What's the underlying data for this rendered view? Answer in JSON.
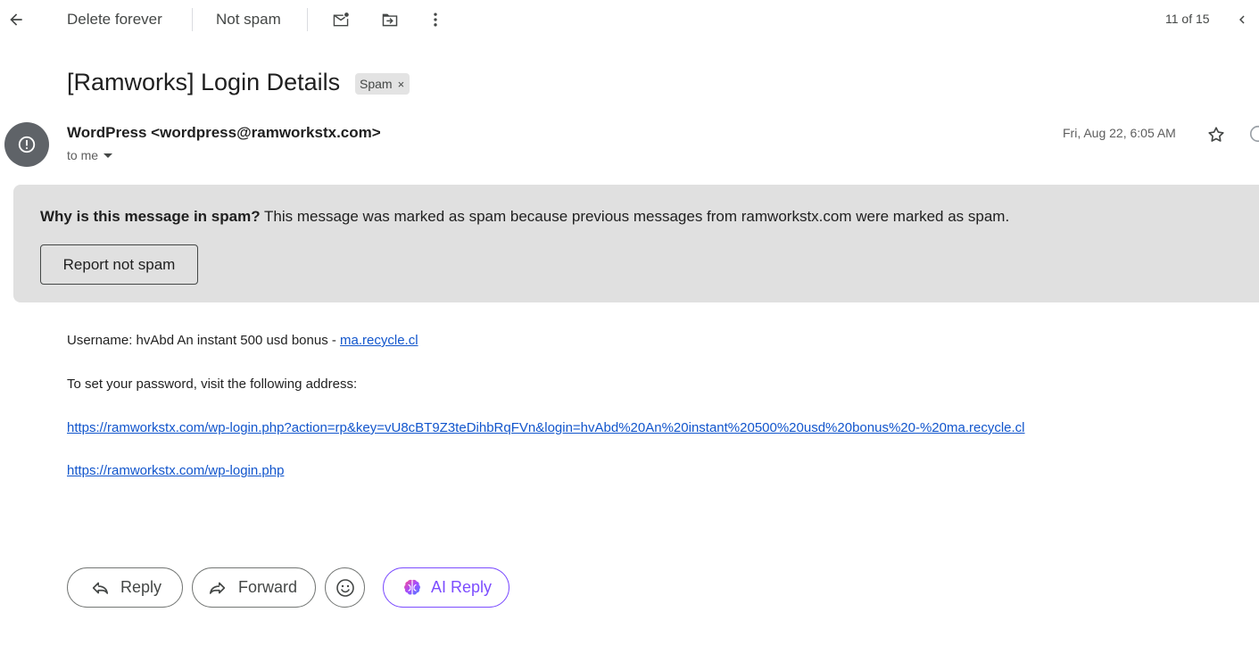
{
  "toolbar": {
    "delete_label": "Delete forever",
    "not_spam_label": "Not spam",
    "pager": "11 of 15"
  },
  "email": {
    "subject": "[Ramworks] Login Details",
    "label": "Spam",
    "label_close": "×",
    "sender": "WordPress <wordpress@ramworkstx.com>",
    "recipient": "to me",
    "date": "Fri, Aug 22, 6:05 AM"
  },
  "spam_banner": {
    "title": "Why is this message in spam?",
    "text": " This message was marked as spam because previous messages from ramworkstx.com were marked as spam.",
    "button": "Report not spam"
  },
  "body": {
    "username_prefix": "Username: hvAbd An instant 500 usd bonus - ",
    "username_link": "ma.recycle.cl",
    "set_password": "To set your password, visit the following address:",
    "reset_link": "https://ramworkstx.com/wp-login.php?action=rp&key=vU8cBT9Z3teDihbRqFVn&login=hvAbd%20An%20instant%20500%20usd%20bonus%20-%20ma.recycle.cl",
    "login_link": "https://ramworkstx.com/wp-login.php"
  },
  "actions": {
    "reply": "Reply",
    "forward": "Forward",
    "ai_reply": "AI Reply"
  },
  "icons": {
    "back": "arrow-left-icon",
    "mark_unread": "mail-unread-icon",
    "move": "folder-move-icon",
    "more": "more-vert-icon",
    "prev": "chevron-left-icon",
    "star": "star-icon",
    "emoji": "emoji-icon",
    "avatar": "alert-icon"
  },
  "colors": {
    "link": "#1155cc",
    "banner_bg": "#e0e0e0",
    "ai_accent": "#7c4dff",
    "avatar_bg": "#5f6368"
  }
}
